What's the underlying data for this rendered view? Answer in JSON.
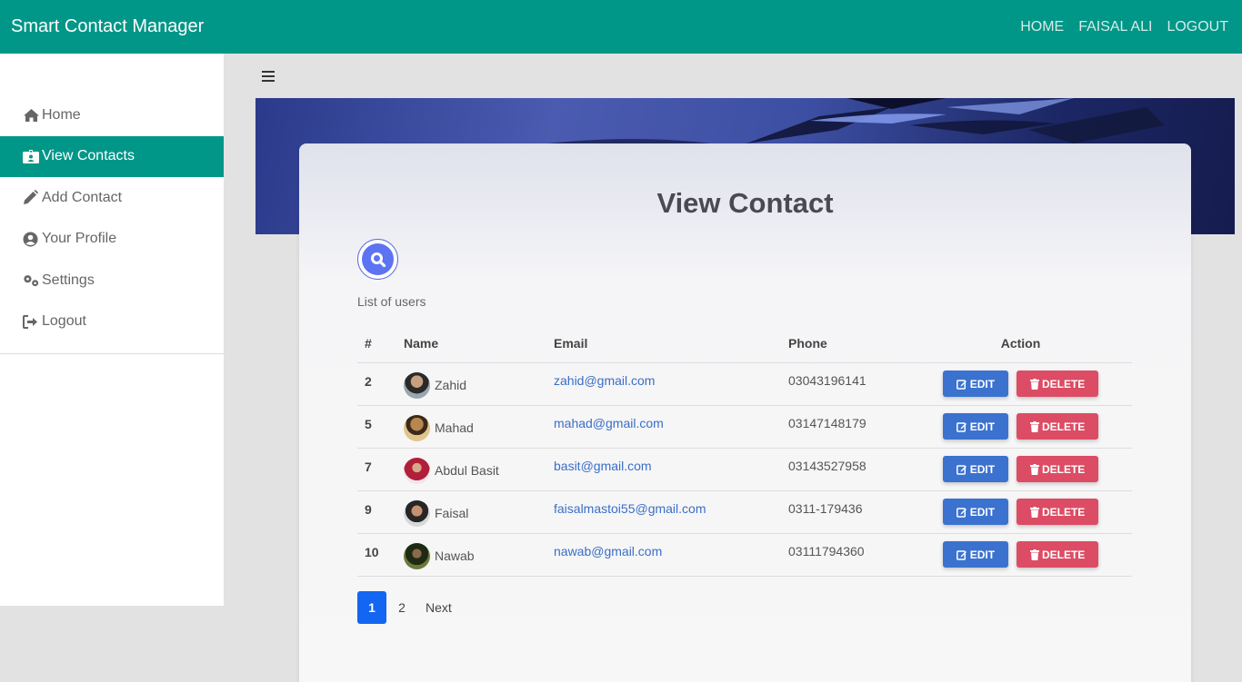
{
  "navbar": {
    "brand": "Smart Contact Manager",
    "links": [
      "HOME",
      "FAISAL ALI",
      "LOGOUT"
    ],
    "color": "#009688"
  },
  "sidebar": {
    "items": [
      {
        "label": "Home",
        "icon": "home-icon"
      },
      {
        "label": "View Contacts",
        "icon": "id-card-icon",
        "active": true
      },
      {
        "label": "Add Contact",
        "icon": "pencil-icon"
      },
      {
        "label": "Your Profile",
        "icon": "user-circle-icon"
      },
      {
        "label": "Settings",
        "icon": "gears-icon"
      },
      {
        "label": "Logout",
        "icon": "sign-out-icon"
      }
    ]
  },
  "main": {
    "title": "View Contact",
    "list_label": "List of users",
    "table": {
      "headers": [
        "#",
        "Name",
        "Email",
        "Phone",
        "Action"
      ],
      "rows": [
        {
          "id": "2",
          "name": "Zahid",
          "email": "zahid@gmail.com",
          "phone": "03043196141"
        },
        {
          "id": "5",
          "name": "Mahad",
          "email": "mahad@gmail.com",
          "phone": "03147148179"
        },
        {
          "id": "7",
          "name": "Abdul Basit",
          "email": "basit@gmail.com",
          "phone": "03143527958"
        },
        {
          "id": "9",
          "name": "Faisal",
          "email": "faisalmastoi55@gmail.com",
          "phone": "0311-179436"
        },
        {
          "id": "10",
          "name": "Nawab",
          "email": "nawab@gmail.com",
          "phone": "03111794360"
        }
      ],
      "edit_label": "EDIT",
      "delete_label": "DELETE"
    },
    "pagination": {
      "pages": [
        "1",
        "2"
      ],
      "current": "1",
      "next_label": "Next"
    }
  },
  "colors": {
    "accent": "#009688",
    "edit": "#3b72cf",
    "delete": "#dc4c64",
    "link": "#3a6ec7",
    "page_active": "#1266f1"
  }
}
